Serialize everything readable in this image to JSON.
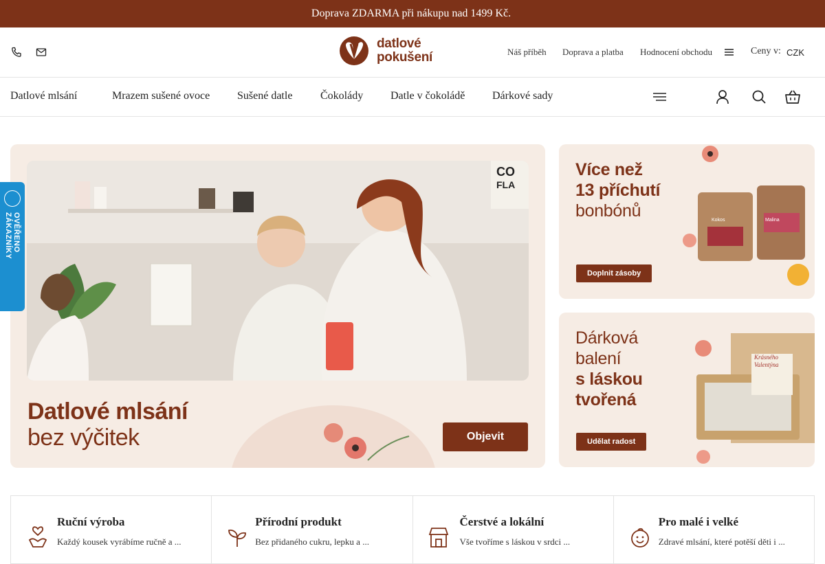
{
  "promo": {
    "text": "Doprava ZDARMA při nákupu nad 1499 Kč. ",
    "arrow": "",
    "close": ""
  },
  "header": {
    "logo_line1": "datlové",
    "logo_line2": "pokušení",
    "links": [
      "Náš příběh",
      "Doprava a platba",
      "Hodnocení obchodu"
    ],
    "currency_label": "Ceny v:",
    "currency_value": "CZK",
    "currency_caret": ""
  },
  "nav": {
    "items": [
      "Datlové mlsání",
      "Mrazem sušené ovoce",
      "Sušené datle",
      "Čokolády",
      "Datle v čokoládě",
      "Dárkové sady"
    ],
    "dropdown_caret": ""
  },
  "hero": {
    "title_line1": "Datlové mlsání",
    "title_line2": "bez výčitek",
    "button": "Objevit"
  },
  "side_banners": [
    {
      "title_line1": "Více než",
      "title_line2": "13 příchutí",
      "title_line3": "bonbónů",
      "button": "Doplnit zásoby",
      "pack_labels": [
        "Kokos",
        "Malina"
      ]
    },
    {
      "title_line1": "Dárková",
      "title_line2": "balení",
      "title_line3": "s láskou",
      "title_line4": "tvořená",
      "button": "Udělat radost",
      "card_text": "Krásného Valentýna"
    }
  ],
  "verified_badge": {
    "text": "OVĚŘENO ZÁKAZNÍKY"
  },
  "features": [
    {
      "title": "Ruční výroba",
      "text": "Každý kousek vyrábíme ručně a ...",
      "icon": "hand-heart-icon"
    },
    {
      "title": "Přírodní produkt",
      "text": "Bez přidaného cukru, lepku a ...",
      "icon": "sprout-icon"
    },
    {
      "title": "Čerstvé a lokální",
      "text": "Vše tvoříme s láskou v srdci ...",
      "icon": "store-icon"
    },
    {
      "title": "Pro malé i velké",
      "text": "Zdravé mlsání, které potěší děti i ...",
      "icon": "child-face-icon"
    }
  ],
  "colors": {
    "brand": "#7d3218",
    "banner_bg": "#f6ece4",
    "badge": "#1c8fd0"
  }
}
